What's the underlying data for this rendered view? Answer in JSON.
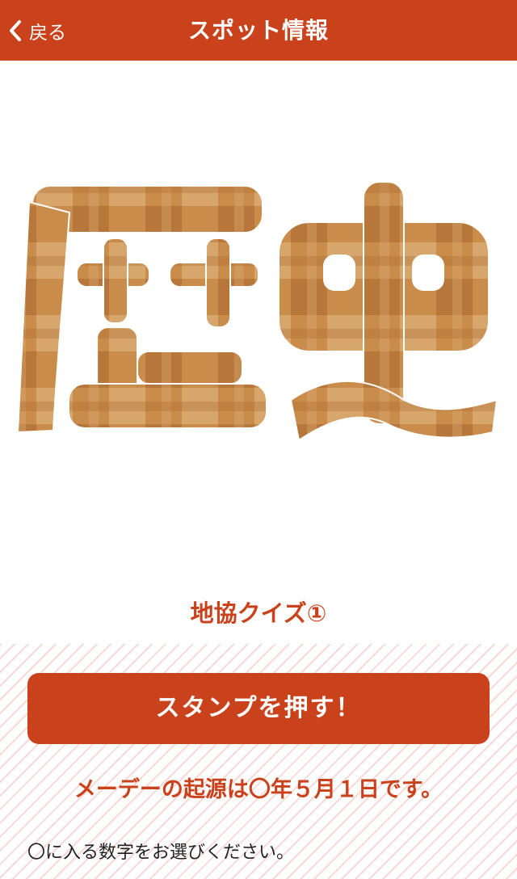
{
  "header": {
    "back_label": "戻る",
    "title": "スポット情報"
  },
  "hero": {
    "characters": [
      "歴",
      "史"
    ],
    "pattern_colors": {
      "base": "#c98c4b",
      "dark": "#a9652b",
      "light": "#dcae76"
    }
  },
  "spot": {
    "name": "地協クイズ①"
  },
  "stamp_button": {
    "label": "スタンプを押す！"
  },
  "quiz": {
    "question": "メーデーの起源は〇年５月１日です。",
    "instruction": "〇に入る数字をお選びください。"
  },
  "colors": {
    "accent": "#c9421c",
    "stripe": "#f7dad6"
  }
}
